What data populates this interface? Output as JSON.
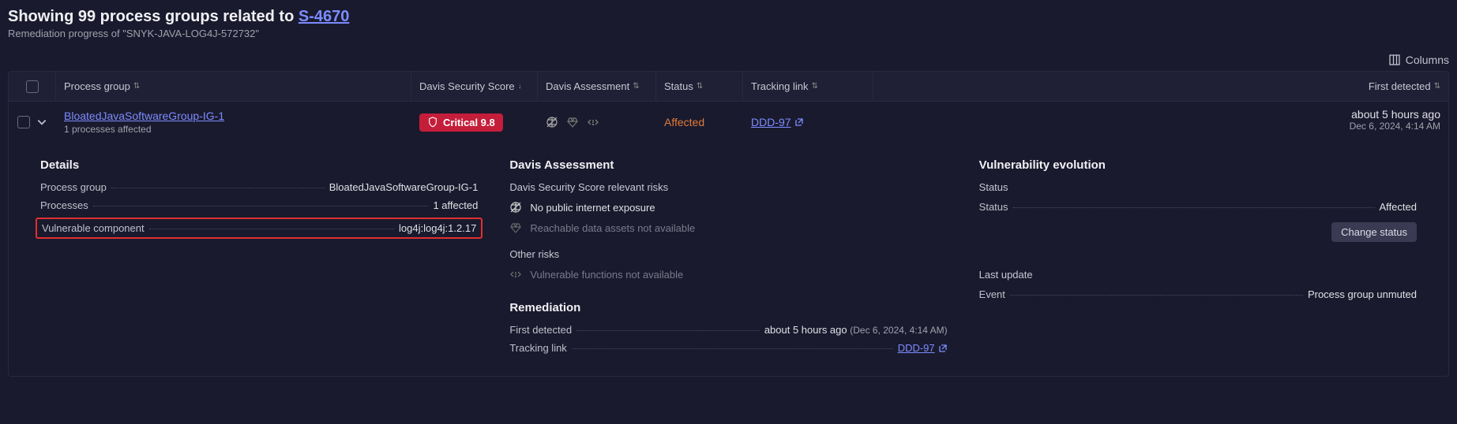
{
  "header": {
    "title_prefix": "Showing 99 process groups related to ",
    "title_link": "S-4670",
    "subtitle": "Remediation progress of \"SNYK-JAVA-LOG4J-572732\""
  },
  "toolbar": {
    "columns_label": "Columns"
  },
  "columns": {
    "process_group": "Process group",
    "dss": "Davis Security Score",
    "assessment": "Davis Assessment",
    "status": "Status",
    "tracking": "Tracking link",
    "first_detected": "First detected"
  },
  "row": {
    "pg_name": "BloatedJavaSoftwareGroup-IG-1",
    "pg_sub": "1 processes affected",
    "dss_label": "Critical 9.8",
    "status": "Affected",
    "tracking_link": "DDD-97",
    "first_rel": "about 5 hours ago",
    "first_abs": "Dec 6, 2024, 4:14 AM"
  },
  "details": {
    "heading": "Details",
    "process_group_k": "Process group",
    "process_group_v": "BloatedJavaSoftwareGroup-IG-1",
    "processes_k": "Processes",
    "processes_v": "1 affected",
    "vuln_comp_k": "Vulnerable component",
    "vuln_comp_v": "log4j:log4j:1.2.17"
  },
  "assessment": {
    "heading": "Davis Assessment",
    "sub1": "Davis Security Score relevant risks",
    "no_internet": "No public internet exposure",
    "reachable_na": "Reachable data assets not available",
    "sub2": "Other risks",
    "vuln_func_na": "Vulnerable functions not available",
    "remediation_heading": "Remediation",
    "first_detected_k": "First detected",
    "first_detected_rel": "about 5 hours ago",
    "first_detected_abs": "(Dec 6, 2024, 4:14 AM)",
    "tracking_k": "Tracking link",
    "tracking_v": "DDD-97"
  },
  "evolution": {
    "heading": "Vulnerability evolution",
    "status_sub": "Status",
    "status_k": "Status",
    "status_v": "Affected",
    "change_btn": "Change status",
    "last_update_sub": "Last update",
    "event_k": "Event",
    "event_v": "Process group unmuted"
  }
}
